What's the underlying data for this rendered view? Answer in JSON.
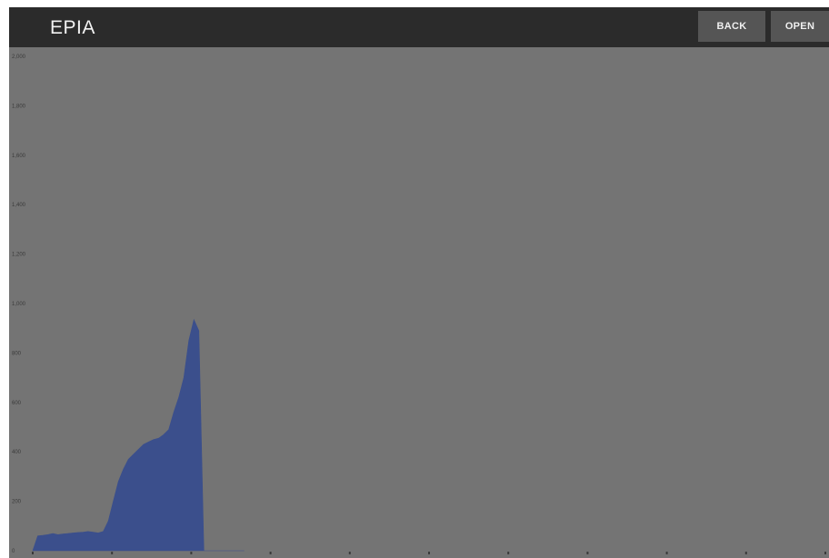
{
  "app_bar": {
    "title": "EPIA",
    "back_label": "BACK",
    "open_label": "OPEN"
  },
  "colors": {
    "app_bar": "#2b2b2b",
    "background": "#747474",
    "area_fill": "#3b4f8c",
    "button": "#555555"
  },
  "chart_data": {
    "type": "area",
    "title": "",
    "xlabel": "",
    "ylabel": "",
    "ylim": [
      0,
      2000
    ],
    "y_tick_labels": [
      "0",
      "200",
      "400",
      "600",
      "800",
      "1,000",
      "1,200",
      "1,400",
      "1,600",
      "1,800",
      "2,000"
    ],
    "x_tick_count": 11,
    "grid": false,
    "series": [
      {
        "color": "#3b4f8c",
        "x": [
          0,
          1,
          2,
          3,
          4,
          5,
          6,
          7,
          8,
          9,
          10,
          11,
          12,
          13,
          14,
          15,
          16,
          17,
          18,
          19,
          20,
          21,
          22,
          23,
          24,
          25,
          26,
          27,
          28,
          29,
          30,
          31,
          32,
          33,
          34,
          35,
          36,
          37,
          38,
          39,
          40,
          41,
          42
        ],
        "y": [
          0,
          60,
          62,
          65,
          70,
          65,
          68,
          70,
          72,
          74,
          75,
          78,
          75,
          72,
          78,
          120,
          200,
          280,
          330,
          370,
          390,
          410,
          430,
          440,
          450,
          455,
          470,
          490,
          560,
          620,
          700,
          850,
          935,
          890,
          0,
          0,
          0,
          0,
          0,
          0,
          0,
          0,
          0
        ]
      }
    ]
  }
}
